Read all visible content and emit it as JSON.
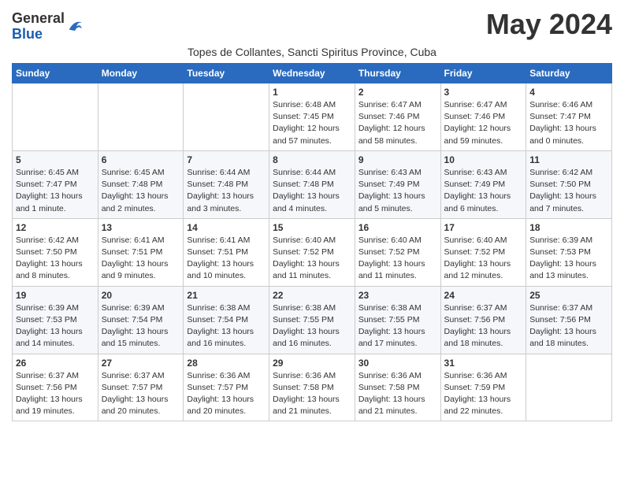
{
  "header": {
    "logo_general": "General",
    "logo_blue": "Blue",
    "month_title": "May 2024",
    "subtitle": "Topes de Collantes, Sancti Spiritus Province, Cuba"
  },
  "days_of_week": [
    "Sunday",
    "Monday",
    "Tuesday",
    "Wednesday",
    "Thursday",
    "Friday",
    "Saturday"
  ],
  "weeks": [
    [
      {
        "day": "",
        "info": ""
      },
      {
        "day": "",
        "info": ""
      },
      {
        "day": "",
        "info": ""
      },
      {
        "day": "1",
        "info": "Sunrise: 6:48 AM\nSunset: 7:45 PM\nDaylight: 12 hours and 57 minutes."
      },
      {
        "day": "2",
        "info": "Sunrise: 6:47 AM\nSunset: 7:46 PM\nDaylight: 12 hours and 58 minutes."
      },
      {
        "day": "3",
        "info": "Sunrise: 6:47 AM\nSunset: 7:46 PM\nDaylight: 12 hours and 59 minutes."
      },
      {
        "day": "4",
        "info": "Sunrise: 6:46 AM\nSunset: 7:47 PM\nDaylight: 13 hours and 0 minutes."
      }
    ],
    [
      {
        "day": "5",
        "info": "Sunrise: 6:45 AM\nSunset: 7:47 PM\nDaylight: 13 hours and 1 minute."
      },
      {
        "day": "6",
        "info": "Sunrise: 6:45 AM\nSunset: 7:48 PM\nDaylight: 13 hours and 2 minutes."
      },
      {
        "day": "7",
        "info": "Sunrise: 6:44 AM\nSunset: 7:48 PM\nDaylight: 13 hours and 3 minutes."
      },
      {
        "day": "8",
        "info": "Sunrise: 6:44 AM\nSunset: 7:48 PM\nDaylight: 13 hours and 4 minutes."
      },
      {
        "day": "9",
        "info": "Sunrise: 6:43 AM\nSunset: 7:49 PM\nDaylight: 13 hours and 5 minutes."
      },
      {
        "day": "10",
        "info": "Sunrise: 6:43 AM\nSunset: 7:49 PM\nDaylight: 13 hours and 6 minutes."
      },
      {
        "day": "11",
        "info": "Sunrise: 6:42 AM\nSunset: 7:50 PM\nDaylight: 13 hours and 7 minutes."
      }
    ],
    [
      {
        "day": "12",
        "info": "Sunrise: 6:42 AM\nSunset: 7:50 PM\nDaylight: 13 hours and 8 minutes."
      },
      {
        "day": "13",
        "info": "Sunrise: 6:41 AM\nSunset: 7:51 PM\nDaylight: 13 hours and 9 minutes."
      },
      {
        "day": "14",
        "info": "Sunrise: 6:41 AM\nSunset: 7:51 PM\nDaylight: 13 hours and 10 minutes."
      },
      {
        "day": "15",
        "info": "Sunrise: 6:40 AM\nSunset: 7:52 PM\nDaylight: 13 hours and 11 minutes."
      },
      {
        "day": "16",
        "info": "Sunrise: 6:40 AM\nSunset: 7:52 PM\nDaylight: 13 hours and 11 minutes."
      },
      {
        "day": "17",
        "info": "Sunrise: 6:40 AM\nSunset: 7:52 PM\nDaylight: 13 hours and 12 minutes."
      },
      {
        "day": "18",
        "info": "Sunrise: 6:39 AM\nSunset: 7:53 PM\nDaylight: 13 hours and 13 minutes."
      }
    ],
    [
      {
        "day": "19",
        "info": "Sunrise: 6:39 AM\nSunset: 7:53 PM\nDaylight: 13 hours and 14 minutes."
      },
      {
        "day": "20",
        "info": "Sunrise: 6:39 AM\nSunset: 7:54 PM\nDaylight: 13 hours and 15 minutes."
      },
      {
        "day": "21",
        "info": "Sunrise: 6:38 AM\nSunset: 7:54 PM\nDaylight: 13 hours and 16 minutes."
      },
      {
        "day": "22",
        "info": "Sunrise: 6:38 AM\nSunset: 7:55 PM\nDaylight: 13 hours and 16 minutes."
      },
      {
        "day": "23",
        "info": "Sunrise: 6:38 AM\nSunset: 7:55 PM\nDaylight: 13 hours and 17 minutes."
      },
      {
        "day": "24",
        "info": "Sunrise: 6:37 AM\nSunset: 7:56 PM\nDaylight: 13 hours and 18 minutes."
      },
      {
        "day": "25",
        "info": "Sunrise: 6:37 AM\nSunset: 7:56 PM\nDaylight: 13 hours and 18 minutes."
      }
    ],
    [
      {
        "day": "26",
        "info": "Sunrise: 6:37 AM\nSunset: 7:56 PM\nDaylight: 13 hours and 19 minutes."
      },
      {
        "day": "27",
        "info": "Sunrise: 6:37 AM\nSunset: 7:57 PM\nDaylight: 13 hours and 20 minutes."
      },
      {
        "day": "28",
        "info": "Sunrise: 6:36 AM\nSunset: 7:57 PM\nDaylight: 13 hours and 20 minutes."
      },
      {
        "day": "29",
        "info": "Sunrise: 6:36 AM\nSunset: 7:58 PM\nDaylight: 13 hours and 21 minutes."
      },
      {
        "day": "30",
        "info": "Sunrise: 6:36 AM\nSunset: 7:58 PM\nDaylight: 13 hours and 21 minutes."
      },
      {
        "day": "31",
        "info": "Sunrise: 6:36 AM\nSunset: 7:59 PM\nDaylight: 13 hours and 22 minutes."
      },
      {
        "day": "",
        "info": ""
      }
    ]
  ]
}
